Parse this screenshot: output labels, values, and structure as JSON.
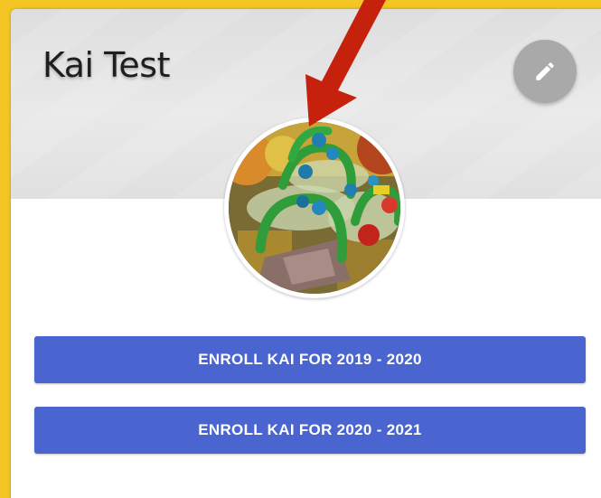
{
  "profile": {
    "name": "Kai Test",
    "avatar_alt": "profile photo"
  },
  "header": {
    "edit_icon": "pencil-icon"
  },
  "actions": [
    {
      "label": "ENROLL KAI FOR 2019 - 2020"
    },
    {
      "label": "ENROLL KAI FOR 2020 - 2021"
    }
  ],
  "colors": {
    "button_bg": "#4a65cf",
    "edit_bg": "#a9a9a9",
    "annotation_arrow": "#c5210d",
    "frame": "#f3c623"
  }
}
